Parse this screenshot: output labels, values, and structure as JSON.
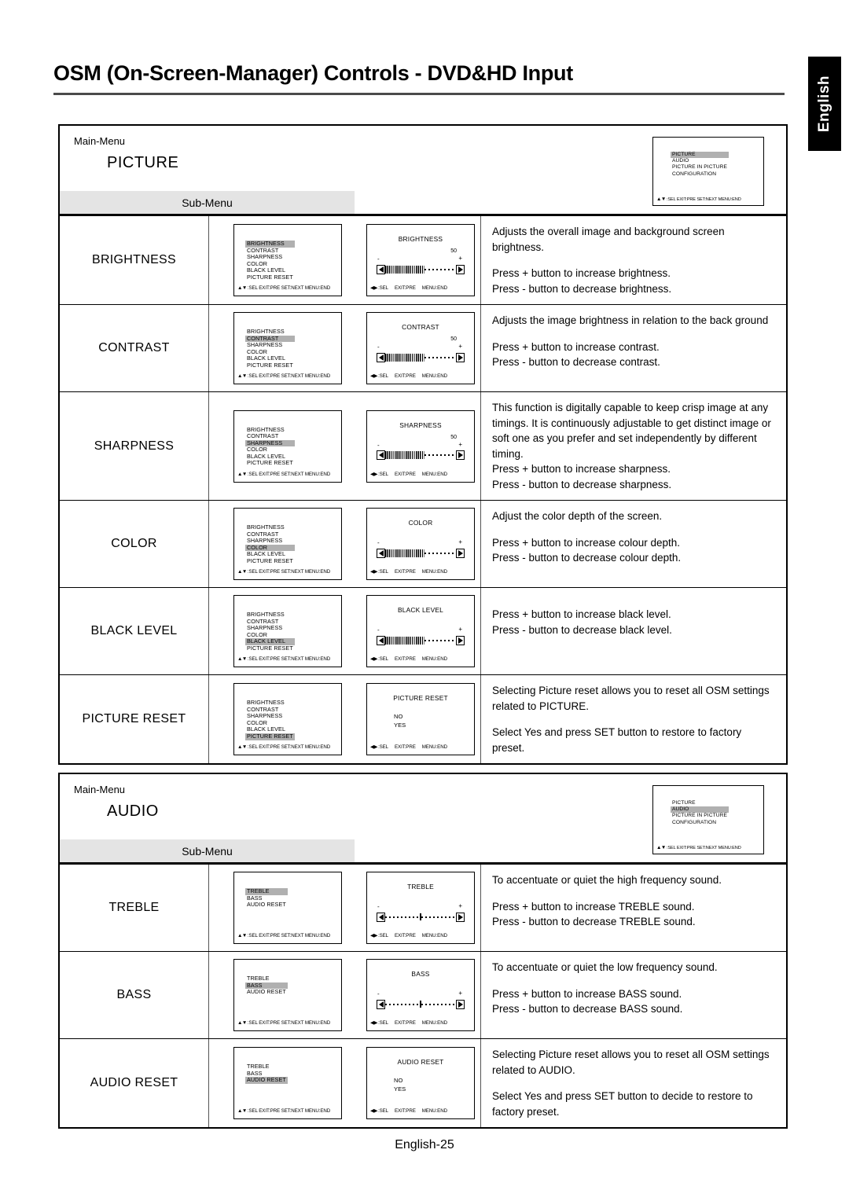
{
  "page": {
    "title": "OSM (On-Screen-Manager) Controls - DVD&HD Input",
    "lang_tab": "English",
    "footer": "English-25"
  },
  "labels": {
    "main_menu": "Main-Menu",
    "sub_menu": "Sub-Menu",
    "osm_foot_list": "▲▼ :SEL EXIT:PRE SET:NEXT MENU:END",
    "osm_foot_sel": ":SEL",
    "osm_foot_exit": "EXIT:PRE",
    "osm_foot_menu": "MENU:END",
    "minus": "-",
    "plus": "+",
    "option_no": "NO",
    "option_yes": "YES"
  },
  "main_menu_items": [
    "PICTURE",
    "AUDIO",
    "PICTURE IN PICTURE",
    "CONFIGURATION"
  ],
  "picture_submenu_items": [
    "BRIGHTNESS",
    "CONTRAST",
    "SHARPNESS",
    "COLOR",
    "BLACK LEVEL",
    "PICTURE RESET"
  ],
  "audio_submenu_items": [
    "TREBLE",
    "BASS",
    "AUDIO RESET"
  ],
  "sections": [
    {
      "id": "picture",
      "main_menu_name": "PICTURE",
      "main_menu_highlight": "PICTURE",
      "rows": [
        {
          "name": "BRIGHTNESS",
          "highlight": "BRIGHTNESS",
          "detail_title": "BRIGHTNESS",
          "value": "50",
          "slider": "filled",
          "desc1": "Adjusts the overall image and background screen brightness.",
          "desc2": "Press + button to increase brightness.",
          "desc3": "Press - button to decrease brightness."
        },
        {
          "name": "CONTRAST",
          "highlight": "CONTRAST",
          "detail_title": "CONTRAST",
          "value": "50",
          "slider": "filled",
          "desc1": "Adjusts the image brightness in relation to the back ground",
          "desc2": "Press + button to increase contrast.",
          "desc3": "Press - button to decrease contrast."
        },
        {
          "name": "SHARPNESS",
          "highlight": "SHARPNESS",
          "detail_title": "SHARPNESS",
          "value": "50",
          "slider": "filled",
          "desc1": "This function is digitally capable to keep crisp image at any timings. It is continuously adjustable to get distinct image or soft one as you prefer and set independently by different timing.",
          "desc2": "Press + button to increase sharpness.",
          "desc3": "Press - button to decrease sharpness.",
          "no_gap": true
        },
        {
          "name": "COLOR",
          "highlight": "COLOR",
          "detail_title": "COLOR",
          "value": "",
          "slider": "filled",
          "desc1": "Adjust the color depth of the screen.",
          "desc2": "Press + button to increase colour depth.",
          "desc3": "Press - button to decrease colour depth."
        },
        {
          "name": "BLACK LEVEL",
          "highlight": "BLACK LEVEL",
          "detail_title": "BLACK LEVEL",
          "value": "",
          "slider": "filled",
          "desc1": "",
          "desc2": "Press + button to increase black level.",
          "desc3": "Press - button to decrease black level."
        },
        {
          "name": "PICTURE RESET",
          "highlight": "PICTURE RESET",
          "detail_title": "PICTURE RESET",
          "value": "",
          "slider": "options",
          "desc1": "Selecting Picture reset allows you to reset all OSM settings related to PICTURE.",
          "desc2": "Select  Yes  and press  SET  button to restore to factory preset.",
          "desc3": ""
        }
      ]
    },
    {
      "id": "audio",
      "main_menu_name": "AUDIO",
      "main_menu_highlight": "AUDIO",
      "rows": [
        {
          "name": "TREBLE",
          "highlight": "TREBLE",
          "detail_title": "TREBLE",
          "value": "",
          "slider": "center",
          "desc1": "To accentuate or quiet the high frequency sound.",
          "desc2": "Press + button to increase TREBLE sound.",
          "desc3": "Press - button to decrease TREBLE sound."
        },
        {
          "name": "BASS",
          "highlight": "BASS",
          "detail_title": "BASS",
          "value": "",
          "slider": "center",
          "desc1": "To accentuate or quiet the low frequency sound.",
          "desc2": "Press + button to increase BASS sound.",
          "desc3": "Press - button to decrease BASS sound."
        },
        {
          "name": "AUDIO RESET",
          "highlight": "AUDIO RESET",
          "detail_title": "AUDIO RESET",
          "value": "",
          "slider": "options",
          "desc1": "Selecting Picture reset allows you to reset all OSM settings related to AUDIO.",
          "desc2": "Select  Yes  and press  SET  button to decide to restore to factory preset.",
          "desc3": ""
        }
      ]
    }
  ]
}
